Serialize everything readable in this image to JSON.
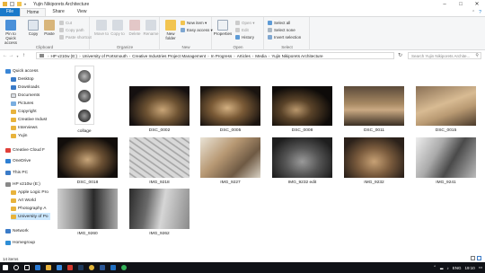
{
  "window": {
    "title": "Yujin Nikiporets Architecture",
    "controls": [
      "–",
      "□",
      "✕"
    ]
  },
  "ribbon_tabs": [
    "File",
    "Home",
    "Share",
    "View"
  ],
  "ribbon": {
    "clipboard": {
      "label": "Clipboard",
      "pin": "Pin to Quick access",
      "copy": "Copy",
      "paste": "Paste",
      "cut": "Cut",
      "copy_path": "Copy path",
      "paste_shortcut": "Paste shortcut"
    },
    "organize": {
      "label": "Organize",
      "move_to": "Move to",
      "copy_to": "Copy to",
      "delete": "Delete",
      "rename": "Rename"
    },
    "new": {
      "label": "New",
      "new_folder": "New folder",
      "new_item": "New item ▾",
      "easy_access": "Easy access ▾"
    },
    "open": {
      "label": "Open",
      "properties": "Properties",
      "open": "Open ▾",
      "edit": "Edit",
      "history": "History"
    },
    "select": {
      "label": "Select",
      "select_all": "Select all",
      "select_none": "Select none",
      "invert": "Invert selection"
    }
  },
  "address": {
    "crumbs": [
      "HP v210w (E:)",
      "University of Portsmouth",
      "Creative Industries Project Management",
      "In Progress",
      "Articles",
      "Media",
      "Yujin Nikiporets Architecture"
    ],
    "search_placeholder": "Search Yujin Nikiporets Archite..."
  },
  "nav": {
    "items": [
      {
        "label": "Quick access"
      },
      {
        "label": "Desktop"
      },
      {
        "label": "Downloads"
      },
      {
        "label": "Documents"
      },
      {
        "label": "Pictures"
      },
      {
        "label": "Copyright"
      },
      {
        "label": "Creative Indust"
      },
      {
        "label": "Interviews"
      },
      {
        "label": "Yujin"
      },
      {
        "label": "Creative Cloud F"
      },
      {
        "label": "OneDrive"
      },
      {
        "label": "This PC"
      },
      {
        "label": "HP v210w (E:)"
      },
      {
        "label": "Apple Logic Pro"
      },
      {
        "label": "Art World"
      },
      {
        "label": "Photography A"
      },
      {
        "label": "University of Po"
      },
      {
        "label": "Network"
      },
      {
        "label": "Homegroup"
      }
    ]
  },
  "files": [
    {
      "name": "collage"
    },
    {
      "name": "DSC_0002"
    },
    {
      "name": "DSC_0005"
    },
    {
      "name": "DSC_0008"
    },
    {
      "name": "DSC_0011"
    },
    {
      "name": "DSC_0015"
    },
    {
      "name": "DSC_0018"
    },
    {
      "name": "IMG_9218"
    },
    {
      "name": "IMG_9227"
    },
    {
      "name": "IMG_9232 edit"
    },
    {
      "name": "IMG_9232"
    },
    {
      "name": "IMG_9241"
    },
    {
      "name": "IMG_9260"
    },
    {
      "name": "IMG_9262"
    }
  ],
  "status": {
    "count": "14 items"
  },
  "taskbar": {
    "lang": "ENG",
    "time": "19:10"
  },
  "colors": {
    "file_tab": "#1979ca",
    "selection": "#cce8ff",
    "taskbar": "#101217"
  }
}
